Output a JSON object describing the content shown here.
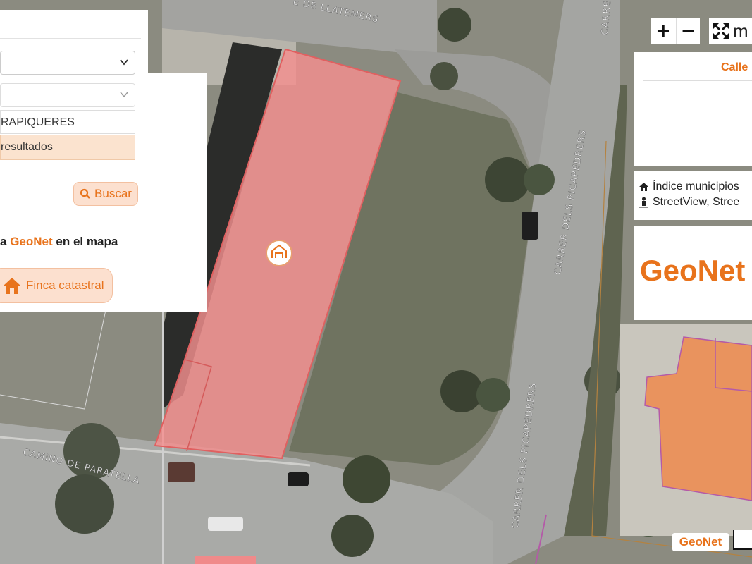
{
  "search_panel": {
    "street_result": "RAPIQUERES",
    "results_label": "resultados",
    "search_button": "Buscar"
  },
  "geonet_line": {
    "prefix": "a",
    "brand": "GeoNet",
    "suffix": "en el mapa"
  },
  "finca_button": "Finca catastral",
  "map_controls": {
    "zoom_in": "+",
    "zoom_out": "−",
    "fullscreen_text": "m"
  },
  "info_panel": {
    "title": "Calle",
    "link_municipios": "Índice municipios",
    "link_streetview": "StreetView, Stree"
  },
  "logo_text": "GeoNet",
  "watermark": "GeoNet",
  "street_labels": {
    "llatemers": "E DE LLATEMERS",
    "picapedrers_upper": "CARRER DELS PICAPEDRERS",
    "picapedrers_lower": "CARRER DELS PICAPEDRERS",
    "paratella": "CAMINO DE PARATELLA",
    "carre_partial": "CARRE"
  },
  "colors": {
    "accent": "#e8731c",
    "parcel_selected": "#f08a8a",
    "parcel_neighbor": "#ef8a4e",
    "satellite_ground": "#8e8f84",
    "road": "#9a9b98"
  }
}
